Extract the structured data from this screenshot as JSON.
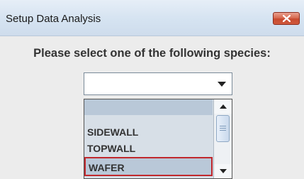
{
  "window": {
    "title": "Setup Data Analysis"
  },
  "dialog": {
    "prompt": "Please select one of the following species:"
  },
  "species_select": {
    "selected_value": "",
    "options": [
      "",
      "SIDEWALL",
      "TOPWALL",
      "WAFER"
    ],
    "highlighted_option": "WAFER"
  },
  "colors": {
    "titlebar": "#d5e3f1",
    "close_button": "#d0593d",
    "dialog_background": "#ececec",
    "selection_highlight": "#b9c8d8",
    "focus_border": "#c0282d"
  },
  "icons": {
    "close": "close-icon",
    "dropdown": "chevron-down-icon",
    "scroll_up": "scroll-up-icon",
    "scroll_down": "scroll-down-icon"
  }
}
